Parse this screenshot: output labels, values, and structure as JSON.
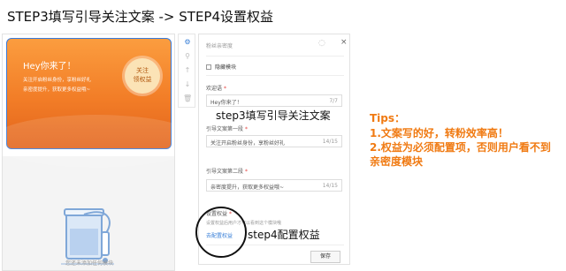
{
  "heading": "STEP3填写引导关注文案 -> STEP4设置权益",
  "preview": {
    "banner_title": "Hey你来了！",
    "banner_line1": "关注开启粉丝身份，享粉丝好礼",
    "banner_line2": "亲密度提升，获取更多权益哦~",
    "follow_badge_line1": "关注",
    "follow_badge_line2": "领权益",
    "empty_text": "您还未添加任何模块"
  },
  "toolbar": {
    "tools": [
      {
        "icon": "gear-icon",
        "glyph": "⚙"
      },
      {
        "icon": "pin-icon",
        "glyph": "⚲"
      },
      {
        "icon": "arrow-up-icon",
        "glyph": "↑"
      },
      {
        "icon": "arrow-down-icon",
        "glyph": "↓"
      },
      {
        "icon": "trash-icon",
        "glyph": "🗑"
      }
    ]
  },
  "panel": {
    "title": "粉丝亲密度",
    "hide_module_label": "隐藏模块",
    "welcome_label": "欢迎语",
    "welcome_value": "Hey你来了！",
    "welcome_count": "7/7",
    "guide1_label": "引导文案第一段",
    "guide1_value": "关注开启粉丝身份，享粉丝好礼",
    "guide1_count": "14/15",
    "guide2_label": "引导文案第二段",
    "guide2_value": "亲密度提升，获取更多权益哦~",
    "guide2_count": "14/15",
    "rights_label": "设置权益",
    "rights_note": "设置权益后用户才可以看到这个模块哦",
    "rights_link": "去配置权益",
    "save_label": "保存"
  },
  "annotations": {
    "step3": "step3填写引导关注文案",
    "step4": "step4配置权益"
  },
  "tips": {
    "title": "Tips：",
    "line1": "1.文案写的好，转粉效率高！",
    "line2": "2.权益为必须配置项，否则用户看不到",
    "line3": "亲密度模块"
  },
  "colors": {
    "accent": "#3a80d8",
    "banner": "#f27d27",
    "tips": "#f07a12",
    "required": "#e64340"
  }
}
